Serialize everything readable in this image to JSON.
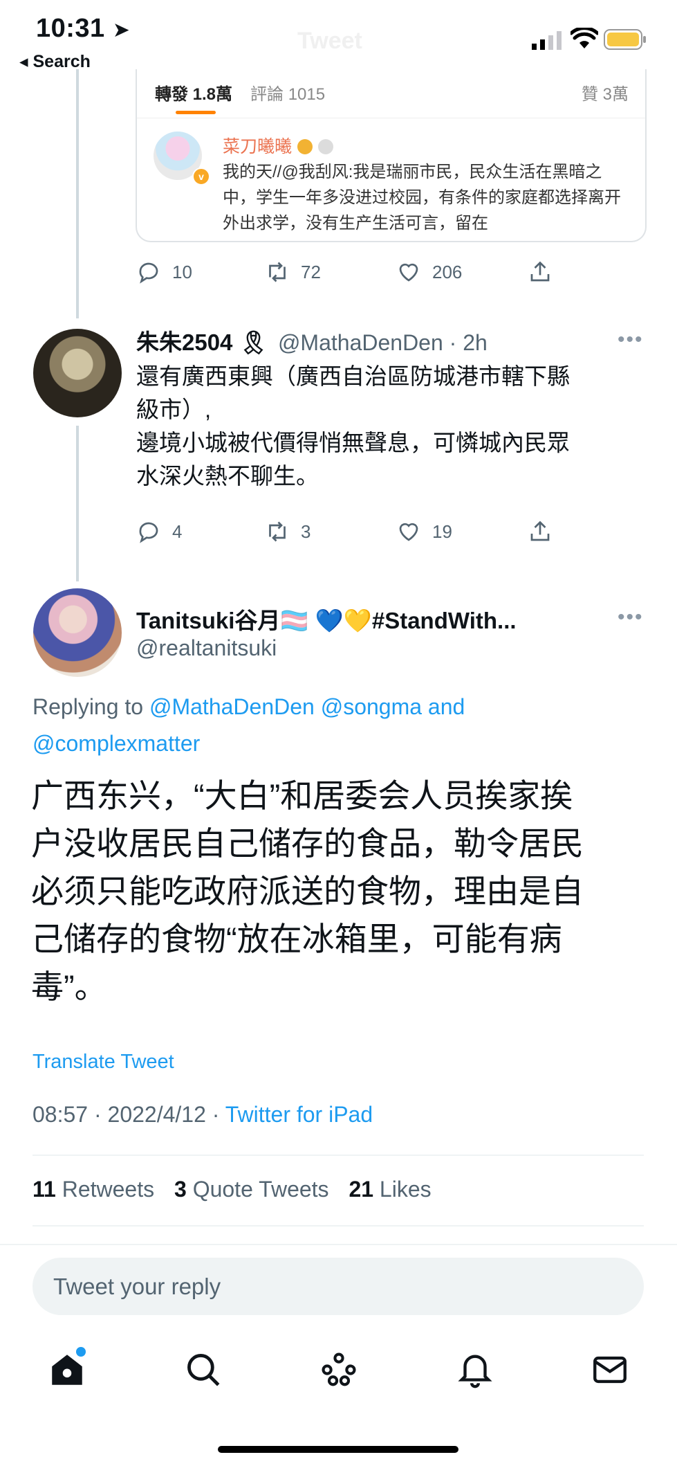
{
  "status_bar": {
    "time": "10:31",
    "back_label": "◂ Search",
    "title": "Tweet"
  },
  "embedded": {
    "tabs": {
      "retweets": "轉發 1.8萬",
      "comments": "評論 1015",
      "likes": "贊 3萬"
    },
    "author": "菜刀曦曦",
    "text": "我的天//@我刮风:我是瑞丽市民，民众生活在黑暗之中，学生一年多没进过校园，有条件的家庭都选择离开外出求学，没有生产生活可言，留在"
  },
  "tweet1_actions": {
    "replies": "10",
    "retweets": "72",
    "likes": "206"
  },
  "tweet2": {
    "name": "朱朱2504 🎗",
    "handle": "@MathaDenDen · 2h",
    "text_lines": [
      "還有廣西東興（廣西自治區防城港市轄下縣",
      "級市）,",
      "邊境小城被代價得悄無聲息，可憐城內民眾",
      "水深火熱不聊生。"
    ],
    "actions": {
      "replies": "4",
      "retweets": "3",
      "likes": "19"
    }
  },
  "main_tweet": {
    "name": "Tanitsuki谷月🏳️‍⚧️ 💙💛#StandWith...",
    "handle": "@realtanitsuki",
    "replying_prefix": "Replying to ",
    "replying_to": "@MathaDenDen @songma",
    "replying_and": " and",
    "replying_to2": "@complexmatter",
    "text_lines": [
      "广西东兴，“大白”和居委会人员挨家挨",
      "户没收居民自己储存的食品，勒令居民",
      "必须只能吃政府派送的食物，理由是自",
      "己储存的食物“放在冰箱里，可能有病",
      "毒”。"
    ],
    "translate": "Translate Tweet",
    "timestamp": "08:57 · 2022/4/12 · ",
    "source": "Twitter for iPad",
    "stats": {
      "retweets_count": "11",
      "retweets_label": "Retweets",
      "quotes_count": "3",
      "quotes_label": "Quote Tweets",
      "likes_count": "21",
      "likes_label": "Likes"
    }
  },
  "reply_placeholder": "Tweet your reply",
  "tab_bar": [
    "home-icon",
    "search-icon",
    "spaces-icon",
    "notifications-icon",
    "messages-icon"
  ],
  "colors": {
    "accent": "#1d9bf0",
    "weibo_orange": "#ff8200",
    "text": "#0f1419",
    "secondary": "#536471"
  }
}
